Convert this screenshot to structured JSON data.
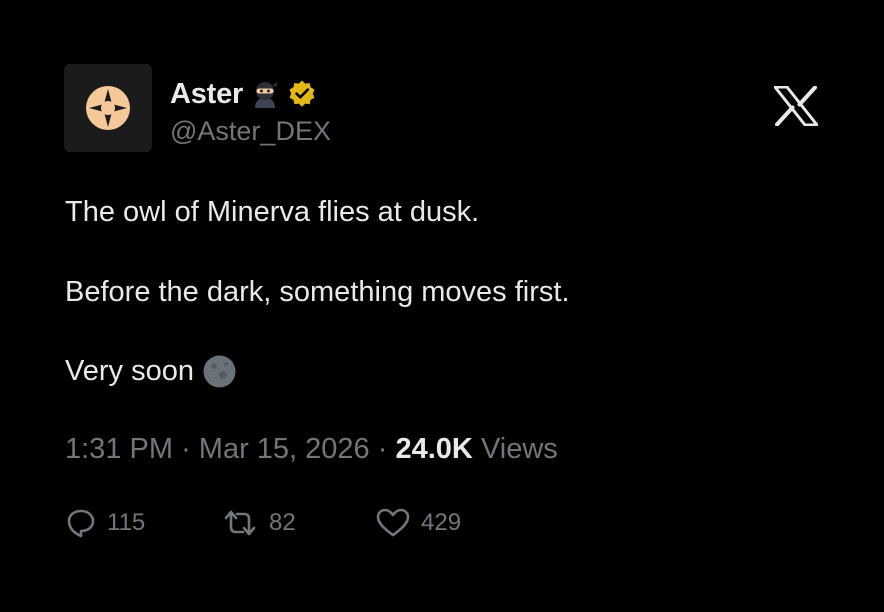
{
  "author": {
    "display_name": "Aster",
    "handle": "@Aster_DEX",
    "verified": true,
    "badge_emoji": "ninja",
    "avatar_icon": "aster-logo-icon"
  },
  "platform_logo": "x-logo-icon",
  "tweet": {
    "line1": "The owl of Minerva flies at dusk.",
    "line2": "Before the dark, something moves first.",
    "line3": "Very soon",
    "line3_emoji": "new-moon"
  },
  "meta": {
    "time": "1:31 PM",
    "separator": "·",
    "date": "Mar 15, 2026",
    "views_count": "24.0K",
    "views_label": "Views"
  },
  "actions": {
    "replies": "115",
    "retweets": "82",
    "likes": "429"
  },
  "colors": {
    "background": "#000000",
    "primary_text": "#e7e9ea",
    "secondary_text": "#71767b",
    "verified_badge": "#e2b719",
    "logo_accent": "#f5c89a"
  }
}
